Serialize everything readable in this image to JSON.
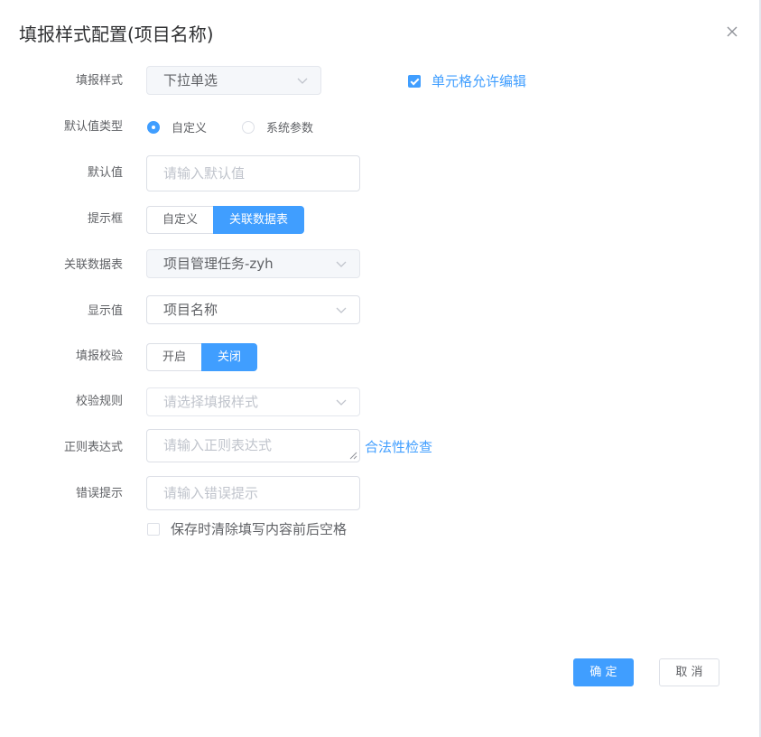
{
  "dialog": {
    "title": "填报样式配置(项目名称)",
    "close_icon": "close-icon"
  },
  "form": {
    "fill_style": {
      "label": "填报样式",
      "value": "下拉单选",
      "allow_edit_label": "单元格允许编辑",
      "allow_edit_checked": true
    },
    "default_type": {
      "label": "默认值类型",
      "options": [
        "自定义",
        "系统参数"
      ],
      "selected": "自定义"
    },
    "default_value": {
      "label": "默认值",
      "placeholder": "请输入默认值"
    },
    "prompt_box": {
      "label": "提示框",
      "options": [
        "自定义",
        "关联数据表"
      ],
      "active": "关联数据表"
    },
    "linked_table": {
      "label": "关联数据表",
      "value": "项目管理任务-zyh"
    },
    "display_value": {
      "label": "显示值",
      "value": "项目名称"
    },
    "validation": {
      "label": "填报校验",
      "options": [
        "开启",
        "关闭"
      ],
      "active": "关闭"
    },
    "validation_rule": {
      "label": "校验规则",
      "placeholder": "请选择填报样式"
    },
    "regex": {
      "label": "正则表达式",
      "placeholder": "请输入正则表达式",
      "check_link": "合法性检查"
    },
    "error_tip": {
      "label": "错误提示",
      "placeholder": "请输入错误提示"
    },
    "trim_whitespace": {
      "label": "保存时清除填写内容前后空格",
      "checked": false
    }
  },
  "footer": {
    "confirm": "确 定",
    "cancel": "取 消"
  },
  "colors": {
    "primary": "#409eff",
    "text": "#606266",
    "placeholder": "#c0c4cc",
    "border": "#dcdfe6"
  }
}
